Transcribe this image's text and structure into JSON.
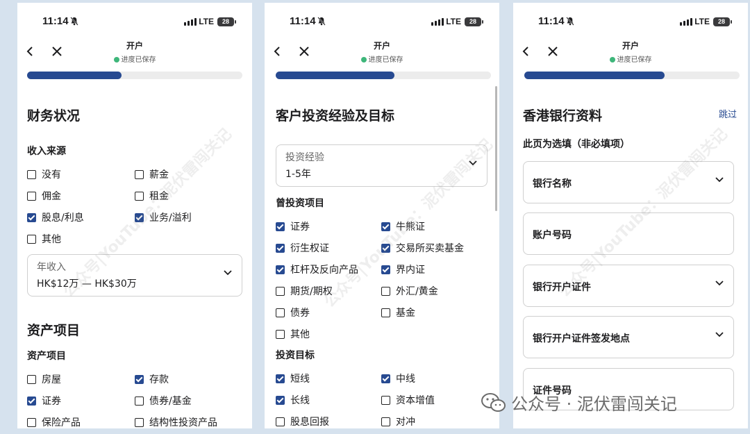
{
  "status": {
    "time": "11:14",
    "network": "LTE",
    "battery": "28"
  },
  "nav": {
    "title": "开户",
    "saved": "进度已保存"
  },
  "watermark": {
    "diag": "公众号|YouTube：泥伏雷闯关记",
    "bottom": "公众号 · 泥伏雷闯关记"
  },
  "colors": {
    "accent": "#274a91",
    "saved_dot": "#3eb67a",
    "background": "#d6e2ee"
  },
  "screens": [
    {
      "progress_pct": 44,
      "title": "财务状况",
      "income": {
        "label": "收入来源",
        "options": [
          {
            "label": "没有",
            "checked": false
          },
          {
            "label": "薪金",
            "checked": false
          },
          {
            "label": "佣金",
            "checked": false
          },
          {
            "label": "租金",
            "checked": false
          },
          {
            "label": "股息/利息",
            "checked": true
          },
          {
            "label": "业务/溢利",
            "checked": true
          },
          {
            "label": "其他",
            "checked": false
          }
        ]
      },
      "annual_income": {
        "label": "年收入",
        "value": "HK$12万 — HK$30万"
      },
      "assets_title": "资产项目",
      "assets": {
        "label": "资产项目",
        "options": [
          {
            "label": "房屋",
            "checked": false
          },
          {
            "label": "存款",
            "checked": true
          },
          {
            "label": "证券",
            "checked": true
          },
          {
            "label": "债券/基金",
            "checked": false
          },
          {
            "label": "保险产品",
            "checked": false
          },
          {
            "label": "结构性投资产品",
            "checked": false
          }
        ]
      }
    },
    {
      "progress_pct": 55,
      "title": "客户投资经验及目标",
      "experience": {
        "label": "投资经验",
        "value": "1-5年"
      },
      "past": {
        "label": "曾投资项目",
        "options": [
          {
            "label": "证券",
            "checked": true
          },
          {
            "label": "牛熊证",
            "checked": true
          },
          {
            "label": "衍生权证",
            "checked": true
          },
          {
            "label": "交易所买卖基金",
            "checked": true
          },
          {
            "label": "杠杆及反向产品",
            "checked": true
          },
          {
            "label": "界内证",
            "checked": true
          },
          {
            "label": "期货/期权",
            "checked": false
          },
          {
            "label": "外汇/黄金",
            "checked": false
          },
          {
            "label": "债券",
            "checked": false
          },
          {
            "label": "基金",
            "checked": false
          },
          {
            "label": "其他",
            "checked": false
          }
        ]
      },
      "goals": {
        "label": "投资目标",
        "options": [
          {
            "label": "短线",
            "checked": true
          },
          {
            "label": "中线",
            "checked": true
          },
          {
            "label": "长线",
            "checked": true
          },
          {
            "label": "资本增值",
            "checked": false
          },
          {
            "label": "股息回报",
            "checked": false
          },
          {
            "label": "对冲",
            "checked": false
          }
        ]
      }
    },
    {
      "progress_pct": 65,
      "title": "香港银行资料",
      "skip": "跳过",
      "subtitle": "此页为选填（非必填项）",
      "fields": [
        {
          "label": "银行名称",
          "dropdown": true
        },
        {
          "label": "账户号码",
          "dropdown": false
        },
        {
          "label": "银行开户证件",
          "dropdown": true
        },
        {
          "label": "银行开户证件签发地点",
          "dropdown": true
        },
        {
          "label": "证件号码",
          "dropdown": false
        }
      ]
    }
  ]
}
